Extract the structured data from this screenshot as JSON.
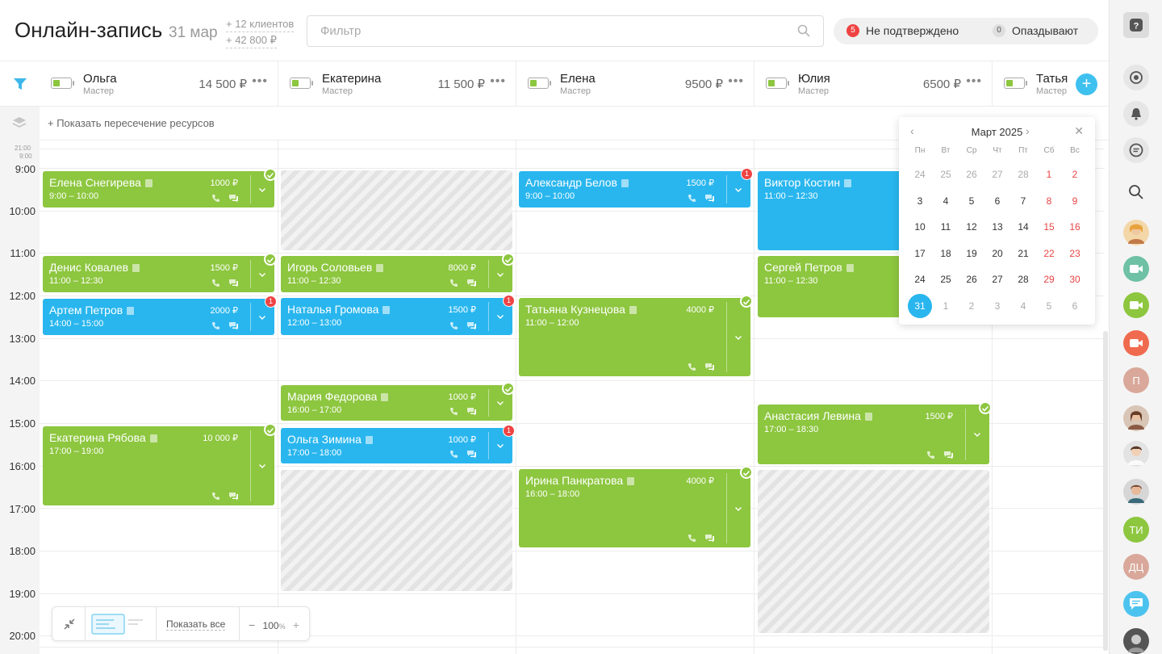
{
  "header": {
    "title": "Онлайн-запись",
    "date": "31 мар",
    "clients": "+ 12 клиентов",
    "revenue": "+ 42 800 ₽",
    "filter_placeholder": "Фильтр",
    "unconfirmed_count": "5",
    "unconfirmed_label": "Не подтверждено",
    "late_count": "0",
    "late_label": "Опаздывают"
  },
  "masters": [
    {
      "name": "Ольга",
      "role": "Мастер",
      "sum": "14 500 ₽"
    },
    {
      "name": "Екатерина",
      "role": "Мастер",
      "sum": "11 500 ₽"
    },
    {
      "name": "Елена",
      "role": "Мастер",
      "sum": "9500 ₽"
    },
    {
      "name": "Юлия",
      "role": "Мастер",
      "sum": "6500 ₽"
    },
    {
      "name": "Татья",
      "role": "Мастер",
      "sum": ""
    }
  ],
  "intersection_label": "+ Показать пересечение ресурсов",
  "small_times": [
    "21:00",
    "9:00"
  ],
  "times": [
    "9:00",
    "10:00",
    "11:00",
    "12:00",
    "13:00",
    "14:00",
    "15:00",
    "16:00",
    "17:00",
    "18:00",
    "19:00",
    "20:00"
  ],
  "events": [
    {
      "name": "Елена Снегирева",
      "time": "9:00 – 10:00",
      "price": "1000 ₽",
      "status": "confirmed"
    },
    {
      "name": "Денис Ковалев",
      "time": "11:00 – 12:30",
      "price": "1500 ₽",
      "status": "confirmed"
    },
    {
      "name": "Артем Петров",
      "time": "14:00 – 15:00",
      "price": "2000 ₽",
      "status": "unconfirmed",
      "alert": "1"
    },
    {
      "name": "Екатерина Рябова",
      "time": "17:00 – 19:00",
      "price": "10 000 ₽",
      "status": "confirmed"
    },
    {
      "name": "Игорь Соловьев",
      "time": "11:00 – 12:30",
      "price": "8000 ₽",
      "status": "confirmed"
    },
    {
      "name": "Наталья Громова",
      "time": "12:00 – 13:00",
      "price": "1500 ₽",
      "status": "unconfirmed",
      "alert": "1"
    },
    {
      "name": "Мария Федорова",
      "time": "16:00 – 17:00",
      "price": "1000 ₽",
      "status": "confirmed"
    },
    {
      "name": "Ольга Зимина",
      "time": "17:00 – 18:00",
      "price": "1000 ₽",
      "status": "unconfirmed",
      "alert": "1"
    },
    {
      "name": "Александр Белов",
      "time": "9:00 – 10:00",
      "price": "1500 ₽",
      "status": "unconfirmed",
      "alert": "1"
    },
    {
      "name": "Татьяна Кузнецова",
      "time": "11:00 – 12:00",
      "price": "4000 ₽",
      "status": "confirmed"
    },
    {
      "name": "Ирина Панкратова",
      "time": "16:00 – 18:00",
      "price": "4000 ₽",
      "status": "confirmed"
    },
    {
      "name": "Виктор Костин",
      "time": "11:00 – 12:30",
      "price": "",
      "status": "unconfirmed"
    },
    {
      "name": "Сергей Петров",
      "time": "11:00 – 12:30",
      "price": "",
      "status": "confirmed"
    },
    {
      "name": "Анастасия Левина",
      "time": "17:00 – 18:30",
      "price": "1500 ₽",
      "status": "confirmed"
    }
  ],
  "calendar": {
    "title": "Март 2025",
    "weekdays": [
      "Пн",
      "Вт",
      "Ср",
      "Чт",
      "Пт",
      "Сб",
      "Вс"
    ],
    "weeks": [
      [
        "24",
        "25",
        "26",
        "27",
        "28",
        "1",
        "2"
      ],
      [
        "3",
        "4",
        "5",
        "6",
        "7",
        "8",
        "9"
      ],
      [
        "10",
        "11",
        "12",
        "13",
        "14",
        "15",
        "16"
      ],
      [
        "17",
        "18",
        "19",
        "20",
        "21",
        "22",
        "23"
      ],
      [
        "24",
        "25",
        "26",
        "27",
        "28",
        "29",
        "30"
      ],
      [
        "31",
        "1",
        "2",
        "3",
        "4",
        "5",
        "6"
      ]
    ],
    "selected": "31"
  },
  "toolbar": {
    "show_all": "Показать все",
    "zoom": "100",
    "zoom_unit": "%"
  },
  "sidebar": {
    "avatar_initials": [
      "П",
      "ТИ",
      "ДЦ"
    ]
  },
  "colors": {
    "green": "#8dc63f",
    "blue": "#29b6ee",
    "alert": "#ef4343"
  }
}
